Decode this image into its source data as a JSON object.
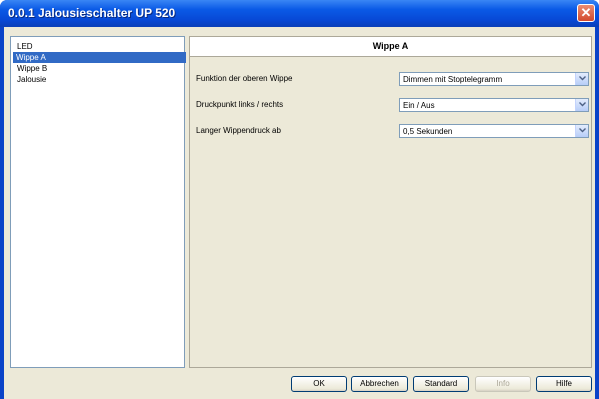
{
  "window": {
    "title": "0.0.1 Jalousieschalter UP 520",
    "close_glyph": "✕"
  },
  "tree": {
    "items": [
      {
        "label": "LED",
        "selected": false
      },
      {
        "label": "Wippe A",
        "selected": true
      },
      {
        "label": "Wippe B",
        "selected": false
      },
      {
        "label": "Jalousie",
        "selected": false
      }
    ]
  },
  "panel": {
    "title": "Wippe A",
    "params": [
      {
        "label": "Funktion der oberen Wippe",
        "value": "Dimmen mit Stoptelegramm"
      },
      {
        "label": "Druckpunkt links / rechts",
        "value": "Ein / Aus"
      },
      {
        "label": "Langer Wippendruck ab",
        "value": "0,5 Sekunden"
      }
    ]
  },
  "buttons": {
    "ok": "OK",
    "cancel": "Abbrechen",
    "standard": "Standard",
    "info": "Info",
    "help": "Hilfe"
  },
  "colors": {
    "titlebar": "#0a5ae6",
    "dialog_bg": "#ece9d8",
    "selection": "#316ac5"
  }
}
